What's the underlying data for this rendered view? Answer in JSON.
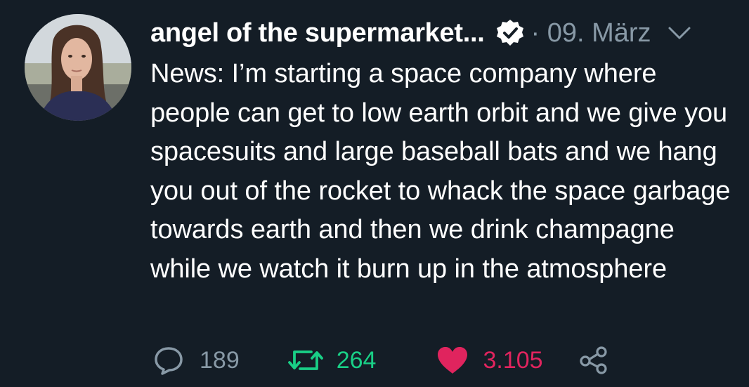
{
  "tweet": {
    "author_name": "angel of the supermarket...",
    "separator_date": "· 09. März",
    "text": "News: I’m starting a space company where people can get to low earth orbit and we give you spacesuits and large baseball bats and we hang you out of the rocket to whack the space garbage towards earth and then we drink champagne while we watch it burn up in the atmosphere",
    "stats": {
      "replies": "189",
      "retweets": "264",
      "likes": "3.105"
    }
  },
  "icons": {
    "verified": "verified-badge-icon",
    "menu": "chevron-down-icon",
    "reply": "speech-bubble-icon",
    "retweet": "retweet-arrows-icon",
    "like": "heart-icon",
    "share": "share-nodes-icon"
  },
  "colors": {
    "background": "#141d26",
    "text": "#ffffff",
    "muted": "#8899a6",
    "retweet": "#19cf86",
    "like": "#e0245e"
  }
}
